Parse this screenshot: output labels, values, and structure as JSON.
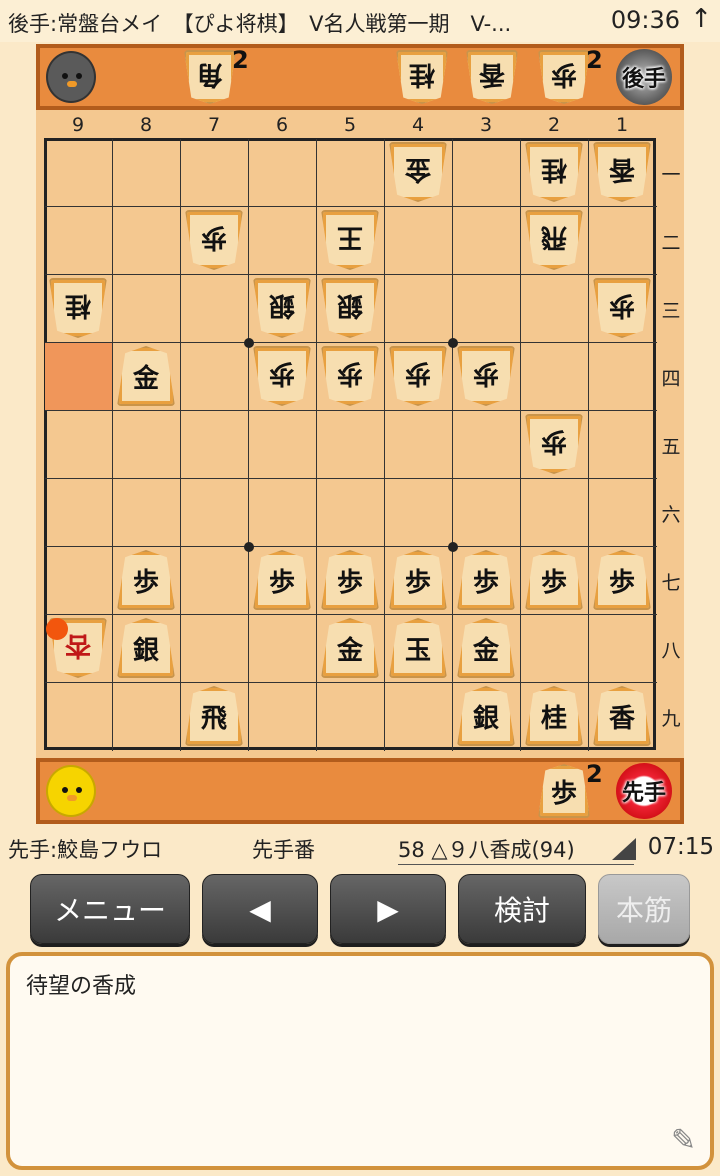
{
  "status": {
    "title": "後手:常盤台メイ　【ぴよ将棋】　V名人戦第一期　V-...",
    "time": "09:36",
    "arrow": "↑"
  },
  "gote": {
    "badge": "後手",
    "hand": [
      {
        "kanji": "角",
        "count": "2"
      },
      {
        "kanji": "桂",
        "count": ""
      },
      {
        "kanji": "香",
        "count": ""
      },
      {
        "kanji": "歩",
        "count": "2"
      }
    ]
  },
  "sente": {
    "badge": "先手",
    "hand": [
      {
        "kanji": "歩",
        "count": "2"
      }
    ]
  },
  "board": {
    "files": [
      "9",
      "8",
      "7",
      "6",
      "5",
      "4",
      "3",
      "2",
      "1"
    ],
    "ranks": [
      "一",
      "二",
      "三",
      "四",
      "五",
      "六",
      "七",
      "八",
      "九"
    ],
    "highlight": {
      "file": 9,
      "rank": 4
    },
    "pieces": [
      {
        "file": 4,
        "rank": 1,
        "kanji": "金",
        "side": "gote"
      },
      {
        "file": 2,
        "rank": 1,
        "kanji": "桂",
        "side": "gote"
      },
      {
        "file": 1,
        "rank": 1,
        "kanji": "香",
        "side": "gote"
      },
      {
        "file": 7,
        "rank": 2,
        "kanji": "歩",
        "side": "gote"
      },
      {
        "file": 5,
        "rank": 2,
        "kanji": "王",
        "side": "gote"
      },
      {
        "file": 2,
        "rank": 2,
        "kanji": "飛",
        "side": "gote"
      },
      {
        "file": 9,
        "rank": 3,
        "kanji": "桂",
        "side": "gote"
      },
      {
        "file": 6,
        "rank": 3,
        "kanji": "銀",
        "side": "gote"
      },
      {
        "file": 5,
        "rank": 3,
        "kanji": "銀",
        "side": "gote"
      },
      {
        "file": 1,
        "rank": 3,
        "kanji": "歩",
        "side": "gote"
      },
      {
        "file": 8,
        "rank": 4,
        "kanji": "金",
        "side": "sente"
      },
      {
        "file": 6,
        "rank": 4,
        "kanji": "歩",
        "side": "gote"
      },
      {
        "file": 5,
        "rank": 4,
        "kanji": "歩",
        "side": "gote"
      },
      {
        "file": 4,
        "rank": 4,
        "kanji": "歩",
        "side": "gote"
      },
      {
        "file": 3,
        "rank": 4,
        "kanji": "歩",
        "side": "gote"
      },
      {
        "file": 2,
        "rank": 5,
        "kanji": "歩",
        "side": "gote"
      },
      {
        "file": 8,
        "rank": 7,
        "kanji": "歩",
        "side": "sente"
      },
      {
        "file": 6,
        "rank": 7,
        "kanji": "歩",
        "side": "sente"
      },
      {
        "file": 5,
        "rank": 7,
        "kanji": "歩",
        "side": "sente"
      },
      {
        "file": 4,
        "rank": 7,
        "kanji": "歩",
        "side": "sente"
      },
      {
        "file": 3,
        "rank": 7,
        "kanji": "歩",
        "side": "sente"
      },
      {
        "file": 2,
        "rank": 7,
        "kanji": "歩",
        "side": "sente"
      },
      {
        "file": 1,
        "rank": 7,
        "kanji": "歩",
        "side": "sente"
      },
      {
        "file": 9,
        "rank": 8,
        "kanji": "杏",
        "side": "gote",
        "red": true
      },
      {
        "file": 8,
        "rank": 8,
        "kanji": "銀",
        "side": "sente"
      },
      {
        "file": 5,
        "rank": 8,
        "kanji": "金",
        "side": "sente"
      },
      {
        "file": 4,
        "rank": 8,
        "kanji": "玉",
        "side": "sente"
      },
      {
        "file": 3,
        "rank": 8,
        "kanji": "金",
        "side": "sente"
      },
      {
        "file": 7,
        "rank": 9,
        "kanji": "飛",
        "side": "sente"
      },
      {
        "file": 3,
        "rank": 9,
        "kanji": "銀",
        "side": "sente"
      },
      {
        "file": 2,
        "rank": 9,
        "kanji": "桂",
        "side": "sente"
      },
      {
        "file": 1,
        "rank": 9,
        "kanji": "香",
        "side": "sente"
      }
    ]
  },
  "info": {
    "sente_player": "先手:鮫島フウロ",
    "turn": "先手番",
    "move": "58 △９八香成(94)",
    "clock": "07:15"
  },
  "buttons": {
    "menu": "メニュー",
    "prev": "◀",
    "next": "▶",
    "study": "検討",
    "mainline": "本筋"
  },
  "comment": {
    "text": "待望の香成",
    "edit_icon": "pencil-icon"
  }
}
